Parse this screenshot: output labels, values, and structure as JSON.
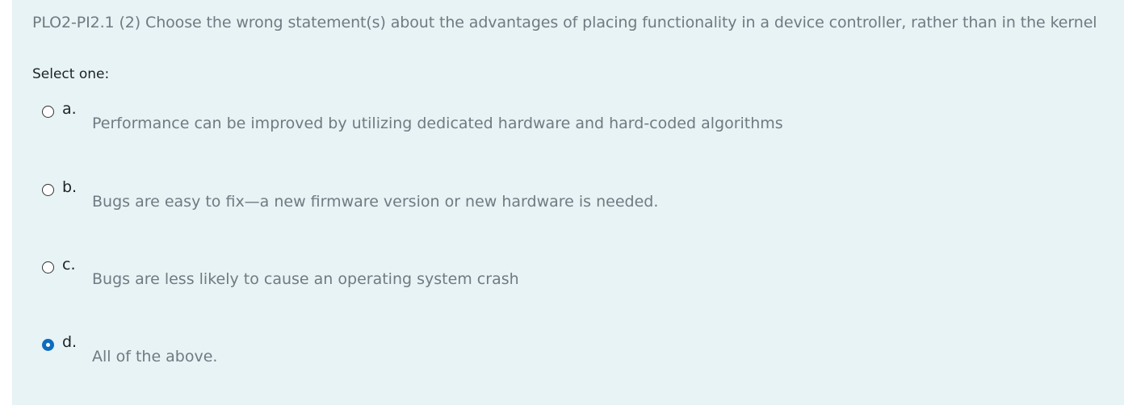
{
  "question": {
    "text": "PLO2-PI2.1 (2) Choose the wrong statement(s) about the advantages of placing functionality in a device controller, rather than in the kernel",
    "prompt": "Select one:"
  },
  "options": [
    {
      "letter": "a.",
      "text": "Performance can be improved by utilizing dedicated hardware and hard-coded algorithms",
      "selected": false
    },
    {
      "letter": "b.",
      "text": "Bugs are easy to fix—a new firmware version or new hardware is needed.",
      "selected": false
    },
    {
      "letter": "c.",
      "text": "Bugs are less likely to cause an operating system crash",
      "selected": false
    },
    {
      "letter": "d.",
      "text": "All of the above.",
      "selected": true
    }
  ],
  "colors": {
    "panel_background": "#e7f3f5",
    "muted_text": "#707a82",
    "dark_text": "#1d2125",
    "radio_selected": "#0f6cbf"
  }
}
